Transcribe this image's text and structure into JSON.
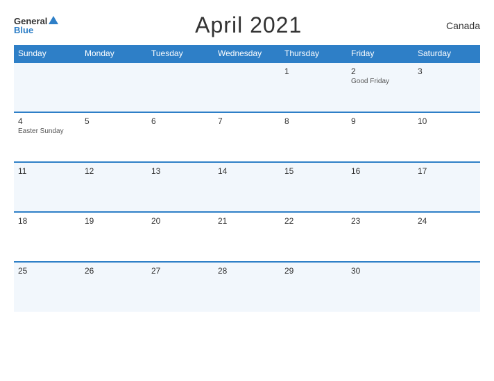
{
  "header": {
    "logo_general": "General",
    "logo_blue": "Blue",
    "title": "April 2021",
    "country": "Canada"
  },
  "days_of_week": [
    "Sunday",
    "Monday",
    "Tuesday",
    "Wednesday",
    "Thursday",
    "Friday",
    "Saturday"
  ],
  "weeks": [
    [
      {
        "num": "",
        "holiday": ""
      },
      {
        "num": "",
        "holiday": ""
      },
      {
        "num": "",
        "holiday": ""
      },
      {
        "num": "",
        "holiday": ""
      },
      {
        "num": "1",
        "holiday": ""
      },
      {
        "num": "2",
        "holiday": "Good Friday"
      },
      {
        "num": "3",
        "holiday": ""
      }
    ],
    [
      {
        "num": "4",
        "holiday": "Easter Sunday"
      },
      {
        "num": "5",
        "holiday": ""
      },
      {
        "num": "6",
        "holiday": ""
      },
      {
        "num": "7",
        "holiday": ""
      },
      {
        "num": "8",
        "holiday": ""
      },
      {
        "num": "9",
        "holiday": ""
      },
      {
        "num": "10",
        "holiday": ""
      }
    ],
    [
      {
        "num": "11",
        "holiday": ""
      },
      {
        "num": "12",
        "holiday": ""
      },
      {
        "num": "13",
        "holiday": ""
      },
      {
        "num": "14",
        "holiday": ""
      },
      {
        "num": "15",
        "holiday": ""
      },
      {
        "num": "16",
        "holiday": ""
      },
      {
        "num": "17",
        "holiday": ""
      }
    ],
    [
      {
        "num": "18",
        "holiday": ""
      },
      {
        "num": "19",
        "holiday": ""
      },
      {
        "num": "20",
        "holiday": ""
      },
      {
        "num": "21",
        "holiday": ""
      },
      {
        "num": "22",
        "holiday": ""
      },
      {
        "num": "23",
        "holiday": ""
      },
      {
        "num": "24",
        "holiday": ""
      }
    ],
    [
      {
        "num": "25",
        "holiday": ""
      },
      {
        "num": "26",
        "holiday": ""
      },
      {
        "num": "27",
        "holiday": ""
      },
      {
        "num": "28",
        "holiday": ""
      },
      {
        "num": "29",
        "holiday": ""
      },
      {
        "num": "30",
        "holiday": ""
      },
      {
        "num": "",
        "holiday": ""
      }
    ]
  ]
}
